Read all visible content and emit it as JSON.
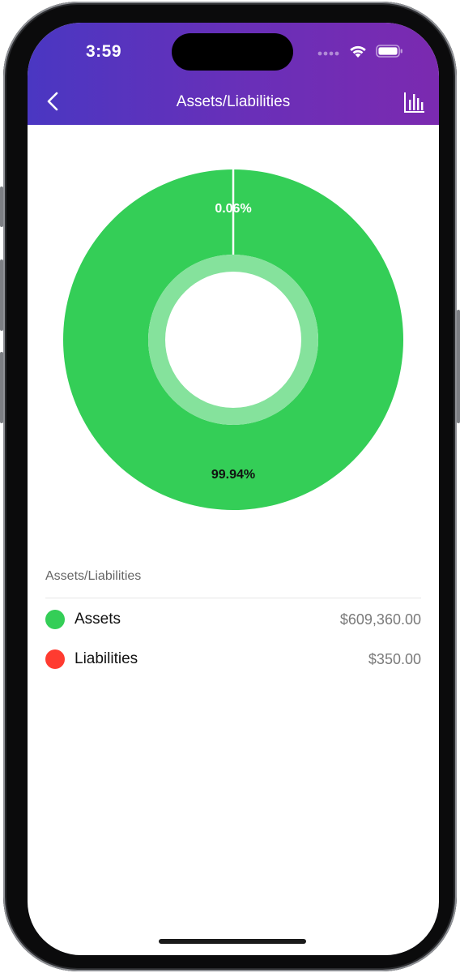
{
  "status_bar": {
    "time": "3:59"
  },
  "header": {
    "title": "Assets/Liabilities",
    "back_icon": "chevron-left-icon",
    "chart_icon": "bar-chart-icon"
  },
  "chart_data": {
    "type": "pie",
    "categories": [
      "Assets",
      "Liabilities"
    ],
    "values": [
      609360.0,
      350.0
    ],
    "percent_labels": [
      "99.94%",
      "0.06%"
    ],
    "colors": [
      "#34CE57",
      "#FF3B30"
    ],
    "title": "",
    "legend_placement": "bottom"
  },
  "legend": {
    "title": "Assets/Liabilities",
    "items": [
      {
        "label": "Assets",
        "value": "$609,360.00",
        "color": "#34CE57"
      },
      {
        "label": "Liabilities",
        "value": "$350.00",
        "color": "#FF3B30"
      }
    ]
  }
}
